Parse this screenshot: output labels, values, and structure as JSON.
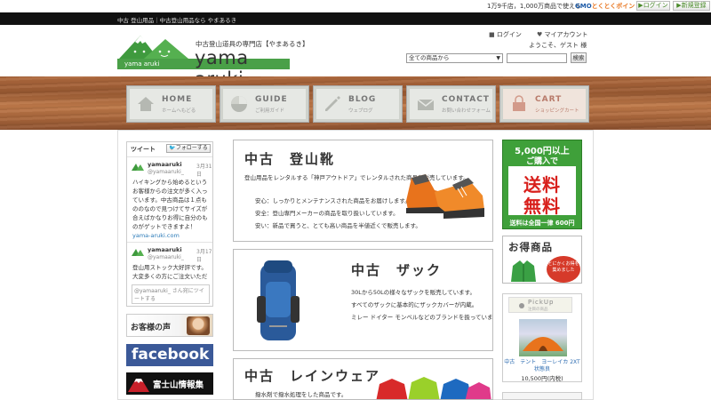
{
  "top": {
    "gmo_text": "1万9千店，1,000万商品で使える",
    "gmo_logo_brand": "GMO",
    "gmo_logo_rest": "とくとくポイント",
    "login_label": "ログイン",
    "register_label": "新規登録"
  },
  "blackbar": {
    "tagline": "中古 登山用品｜中古登山用品なら やまあるき"
  },
  "header": {
    "logo_sub": "中古登山道具の専門店【やまあるき】",
    "logo_main": "yama aruki",
    "logo_ribbon": "yama aruki",
    "login": "ログイン",
    "account": "マイアカウント",
    "welcome": "ようこそ、ゲスト 様",
    "select_value": "全ての商品から",
    "search_button": "検索"
  },
  "nav": [
    {
      "en": "HOME",
      "ja": "ホームへもどる",
      "icon": "home-icon"
    },
    {
      "en": "GUIDE",
      "ja": "ご利用ガイド",
      "icon": "guide-icon"
    },
    {
      "en": "BLOG",
      "ja": "ウェブログ",
      "icon": "pencil-icon"
    },
    {
      "en": "CONTACT",
      "ja": "お問い合わせフォーム",
      "icon": "mail-icon"
    },
    {
      "en": "CART",
      "ja": "ショッピングカート",
      "icon": "cart-icon"
    }
  ],
  "twitter": {
    "title": "ツイート",
    "follow": "フォローする",
    "t1_name": "yamaaruki",
    "t1_handle": "@yamaaruki_",
    "t1_date": "3月31日",
    "t1_text": "ハイキングから始めるという お客様からの注文が多く入っています。中古商品は１点もののなので見つけてサイズが合えばかなりお得に自分のものがゲットできますよ！",
    "t1_link": "yama-aruki.com",
    "t2_name": "yamaaruki",
    "t2_handle": "@yamaaruki_",
    "t2_date": "3月17日",
    "t2_text": "登山用ストック大好評です。大変多くの方にご注文いただ",
    "reply_placeholder": "@yamaaruki_ さん宛にツイートする"
  },
  "banners": {
    "voice": "お客様の声",
    "facebook": "facebook",
    "fuji": "富士山情報集"
  },
  "panels": {
    "boots_title": "中古　登山靴",
    "boots_lines": [
      "登山用品をレンタルする「神戸アウトドア」でレンタルされた商品を販売しています。",
      "安心：しっかりとメンテナンスされた商品をお届けします。",
      "安全：登山専門メーカーの商品を取り扱いしています。",
      "安い：新品で買うと、とても高い商品を半値近くで販売します。"
    ],
    "pack_title": "中古　ザック",
    "pack_lines": [
      "30Lから50Lの様々なザックを販売しています。",
      "すべてのザックに基本的にザックカバーが内蔵。",
      "ミレー ドイター モンベルなどのブランドを扱っています。"
    ],
    "rain_title": "中古　レインウェア",
    "rain_lines": [
      "撥水剤で撥水処理をした商品です。"
    ]
  },
  "promo": {
    "line1": "5,000円以上",
    "line2": "ご購入で",
    "big1": "送料",
    "big2": "無料",
    "line3": "送料は全国一律 600円"
  },
  "deal": {
    "title": "お得商品",
    "circle": "とにかくお得を集めました"
  },
  "pickup": {
    "ribbon": "PickUp",
    "ribbon_sub": "注目の商品",
    "caption": "中古　テント　ヨーレイカ 2XT　状態良",
    "price": "10,500円(内税)"
  },
  "colors": {
    "brand_green": "#4aa048",
    "facebook": "#3b5998",
    "promo_red": "#d8201c",
    "wood": "#a8653a"
  }
}
